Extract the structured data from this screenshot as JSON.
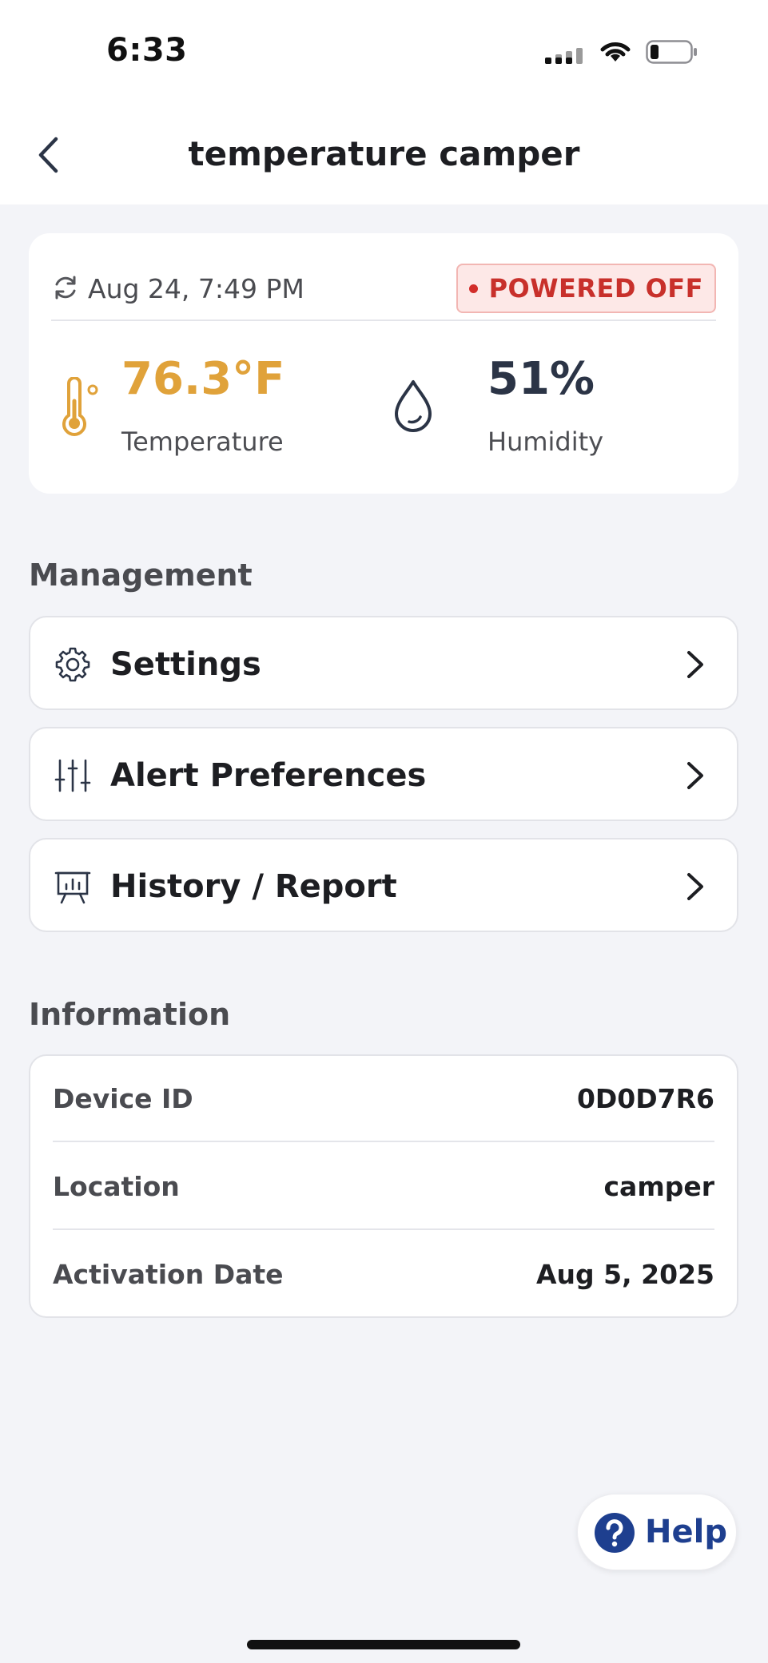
{
  "status_bar": {
    "time": "6:33"
  },
  "header": {
    "title": "temperature camper"
  },
  "reading": {
    "timestamp": "Aug 24, 7:49 PM",
    "status": "POWERED OFF",
    "temperature": {
      "value": "76.3°F",
      "label": "Temperature",
      "color": "#e0a23a"
    },
    "humidity": {
      "value": "51%",
      "label": "Humidity",
      "color": "#2b3446"
    }
  },
  "management": {
    "title": "Management",
    "items": [
      {
        "label": "Settings",
        "icon": "gear-icon"
      },
      {
        "label": "Alert Preferences",
        "icon": "sliders-icon"
      },
      {
        "label": "History / Report",
        "icon": "presentation-chart-icon"
      }
    ]
  },
  "information": {
    "title": "Information",
    "rows": [
      {
        "label": "Device ID",
        "value": "0D0D7R6"
      },
      {
        "label": "Location",
        "value": "camper"
      },
      {
        "label": "Activation Date",
        "value": "Aug 5, 2025"
      }
    ]
  },
  "help": {
    "label": "Help",
    "color": "#1e3f8f"
  },
  "colors": {
    "status_red": "#c8302b",
    "accent_orange": "#e0a23a",
    "background": "#f3f4f8"
  }
}
